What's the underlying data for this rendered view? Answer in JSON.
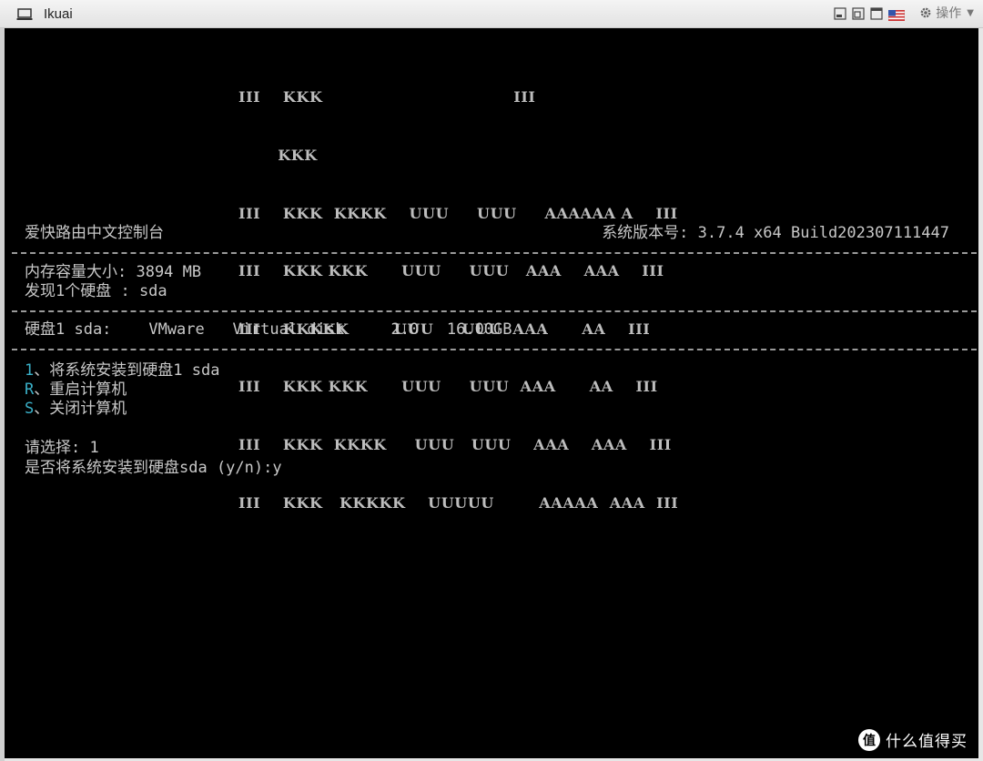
{
  "window": {
    "title": "Ikuai",
    "menu_label": "操作",
    "title_icon": "monitor-icon"
  },
  "terminal": {
    "logo_lines": [
      "III    KKK                                  III",
      "       KKK",
      "III    KKK  KKKK    UUU     UUU     AAAAAA A    III",
      "III    KKK KKK      UUU     UUU   AAA    AAA    III",
      "III    KKKKK        UUU     UUU  AAA      AA    III",
      "III    KKK KKK      UUU     UUU  AAA      AA    III",
      "III    KKK  KKKK     UUU   UUU    AAA    AAA    III",
      "III    KKK   KKKKK    UUUUU        AAAAA  AAA  III"
    ],
    "console_name": "爱快路由中文控制台",
    "version": "系统版本号: 3.7.4 x64 Build202307111447",
    "memory": "内存容量大小: 3894 MB",
    "disk_found": "发现1个硬盘 : sda",
    "disk_info": "硬盘1 sda:    VMware   Virtual disk     2.0   16.00GB",
    "menu": [
      {
        "key": "1",
        "label": "、将系统安装到硬盘1 sda"
      },
      {
        "key": "R",
        "label": "、重启计算机"
      },
      {
        "key": "S",
        "label": "、关闭计算机"
      }
    ],
    "prompt_choice": "请选择: 1",
    "prompt_confirm": "是否将系统安装到硬盘sda (y/n):y"
  },
  "watermark": {
    "logo_char": "值",
    "text": "什么值得买"
  },
  "colors": {
    "menu_key": "#3ab0c8",
    "terminal_bg": "#000000",
    "terminal_fg": "#c8c8c8"
  }
}
